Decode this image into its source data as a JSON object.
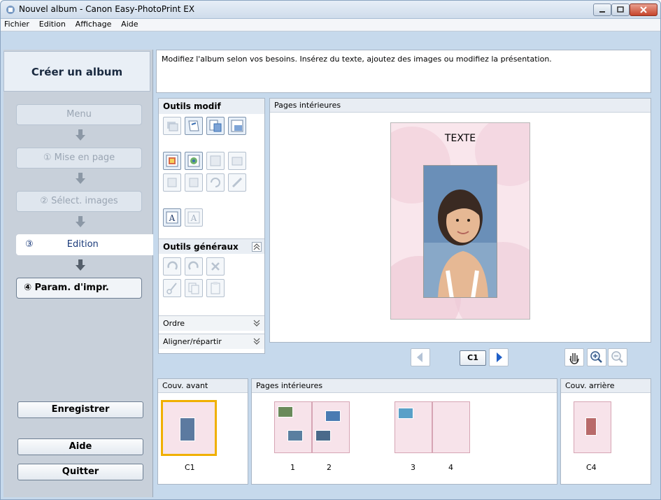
{
  "window": {
    "title": "Nouvel album - Canon Easy-PhotoPrint EX"
  },
  "menu": {
    "items": [
      "Fichier",
      "Edition",
      "Affichage",
      "Aide"
    ]
  },
  "sidebar": {
    "header": "Créer un album",
    "steps": [
      {
        "label": "Menu",
        "state": "disabled"
      },
      {
        "label": "① Mise en page",
        "state": "disabled"
      },
      {
        "label": "② Sélect. images",
        "state": "disabled"
      },
      {
        "num": "③",
        "label": "Edition",
        "state": "active"
      },
      {
        "label": "④ Param. d'impr.",
        "state": "enabled"
      }
    ],
    "save_label": "Enregistrer",
    "help_label": "Aide",
    "quit_label": "Quitter"
  },
  "instruction": "Modifiez l'album selon vos besoins. Insérez du texte, ajoutez des images ou modifiez la présentation.",
  "tools": {
    "edit_header": "Outils modif",
    "general_header": "Outils généraux",
    "order_label": "Ordre",
    "align_label": "Aligner/répartir"
  },
  "preview": {
    "title": "Pages intérieures",
    "page_text": "TEXTE"
  },
  "nav": {
    "page_indicator": "C1"
  },
  "thumbnails": {
    "front_cover": {
      "title": "Couv. avant",
      "label": "C1"
    },
    "inner": {
      "title": "Pages intérieures",
      "labels": [
        "1",
        "2",
        "3",
        "4"
      ]
    },
    "back_cover": {
      "title": "Couv. arrière",
      "label": "C4"
    }
  },
  "colors": {
    "accent": "#1f5fc7",
    "selected_thumb_border": "#f0b000"
  }
}
